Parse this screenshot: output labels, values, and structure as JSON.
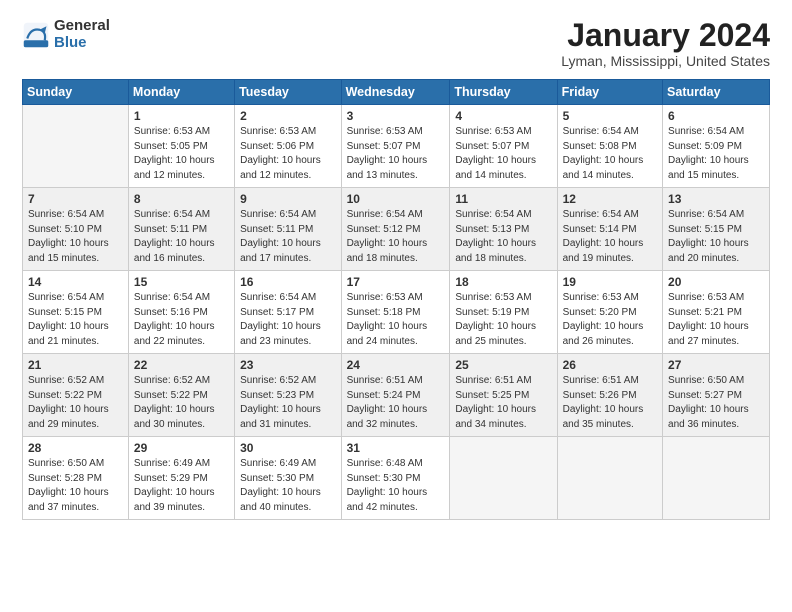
{
  "logo": {
    "general": "General",
    "blue": "Blue"
  },
  "title": "January 2024",
  "subtitle": "Lyman, Mississippi, United States",
  "days_header": [
    "Sunday",
    "Monday",
    "Tuesday",
    "Wednesday",
    "Thursday",
    "Friday",
    "Saturday"
  ],
  "weeks": [
    [
      {
        "day": "",
        "sunrise": "",
        "sunset": "",
        "daylight": "",
        "empty": true
      },
      {
        "day": "1",
        "sunrise": "Sunrise: 6:53 AM",
        "sunset": "Sunset: 5:05 PM",
        "daylight": "Daylight: 10 hours and 12 minutes."
      },
      {
        "day": "2",
        "sunrise": "Sunrise: 6:53 AM",
        "sunset": "Sunset: 5:06 PM",
        "daylight": "Daylight: 10 hours and 12 minutes."
      },
      {
        "day": "3",
        "sunrise": "Sunrise: 6:53 AM",
        "sunset": "Sunset: 5:07 PM",
        "daylight": "Daylight: 10 hours and 13 minutes."
      },
      {
        "day": "4",
        "sunrise": "Sunrise: 6:53 AM",
        "sunset": "Sunset: 5:07 PM",
        "daylight": "Daylight: 10 hours and 14 minutes."
      },
      {
        "day": "5",
        "sunrise": "Sunrise: 6:54 AM",
        "sunset": "Sunset: 5:08 PM",
        "daylight": "Daylight: 10 hours and 14 minutes."
      },
      {
        "day": "6",
        "sunrise": "Sunrise: 6:54 AM",
        "sunset": "Sunset: 5:09 PM",
        "daylight": "Daylight: 10 hours and 15 minutes."
      }
    ],
    [
      {
        "day": "7",
        "sunrise": "Sunrise: 6:54 AM",
        "sunset": "Sunset: 5:10 PM",
        "daylight": "Daylight: 10 hours and 15 minutes."
      },
      {
        "day": "8",
        "sunrise": "Sunrise: 6:54 AM",
        "sunset": "Sunset: 5:11 PM",
        "daylight": "Daylight: 10 hours and 16 minutes."
      },
      {
        "day": "9",
        "sunrise": "Sunrise: 6:54 AM",
        "sunset": "Sunset: 5:11 PM",
        "daylight": "Daylight: 10 hours and 17 minutes."
      },
      {
        "day": "10",
        "sunrise": "Sunrise: 6:54 AM",
        "sunset": "Sunset: 5:12 PM",
        "daylight": "Daylight: 10 hours and 18 minutes."
      },
      {
        "day": "11",
        "sunrise": "Sunrise: 6:54 AM",
        "sunset": "Sunset: 5:13 PM",
        "daylight": "Daylight: 10 hours and 18 minutes."
      },
      {
        "day": "12",
        "sunrise": "Sunrise: 6:54 AM",
        "sunset": "Sunset: 5:14 PM",
        "daylight": "Daylight: 10 hours and 19 minutes."
      },
      {
        "day": "13",
        "sunrise": "Sunrise: 6:54 AM",
        "sunset": "Sunset: 5:15 PM",
        "daylight": "Daylight: 10 hours and 20 minutes."
      }
    ],
    [
      {
        "day": "14",
        "sunrise": "Sunrise: 6:54 AM",
        "sunset": "Sunset: 5:15 PM",
        "daylight": "Daylight: 10 hours and 21 minutes."
      },
      {
        "day": "15",
        "sunrise": "Sunrise: 6:54 AM",
        "sunset": "Sunset: 5:16 PM",
        "daylight": "Daylight: 10 hours and 22 minutes."
      },
      {
        "day": "16",
        "sunrise": "Sunrise: 6:54 AM",
        "sunset": "Sunset: 5:17 PM",
        "daylight": "Daylight: 10 hours and 23 minutes."
      },
      {
        "day": "17",
        "sunrise": "Sunrise: 6:53 AM",
        "sunset": "Sunset: 5:18 PM",
        "daylight": "Daylight: 10 hours and 24 minutes."
      },
      {
        "day": "18",
        "sunrise": "Sunrise: 6:53 AM",
        "sunset": "Sunset: 5:19 PM",
        "daylight": "Daylight: 10 hours and 25 minutes."
      },
      {
        "day": "19",
        "sunrise": "Sunrise: 6:53 AM",
        "sunset": "Sunset: 5:20 PM",
        "daylight": "Daylight: 10 hours and 26 minutes."
      },
      {
        "day": "20",
        "sunrise": "Sunrise: 6:53 AM",
        "sunset": "Sunset: 5:21 PM",
        "daylight": "Daylight: 10 hours and 27 minutes."
      }
    ],
    [
      {
        "day": "21",
        "sunrise": "Sunrise: 6:52 AM",
        "sunset": "Sunset: 5:22 PM",
        "daylight": "Daylight: 10 hours and 29 minutes."
      },
      {
        "day": "22",
        "sunrise": "Sunrise: 6:52 AM",
        "sunset": "Sunset: 5:22 PM",
        "daylight": "Daylight: 10 hours and 30 minutes."
      },
      {
        "day": "23",
        "sunrise": "Sunrise: 6:52 AM",
        "sunset": "Sunset: 5:23 PM",
        "daylight": "Daylight: 10 hours and 31 minutes."
      },
      {
        "day": "24",
        "sunrise": "Sunrise: 6:51 AM",
        "sunset": "Sunset: 5:24 PM",
        "daylight": "Daylight: 10 hours and 32 minutes."
      },
      {
        "day": "25",
        "sunrise": "Sunrise: 6:51 AM",
        "sunset": "Sunset: 5:25 PM",
        "daylight": "Daylight: 10 hours and 34 minutes."
      },
      {
        "day": "26",
        "sunrise": "Sunrise: 6:51 AM",
        "sunset": "Sunset: 5:26 PM",
        "daylight": "Daylight: 10 hours and 35 minutes."
      },
      {
        "day": "27",
        "sunrise": "Sunrise: 6:50 AM",
        "sunset": "Sunset: 5:27 PM",
        "daylight": "Daylight: 10 hours and 36 minutes."
      }
    ],
    [
      {
        "day": "28",
        "sunrise": "Sunrise: 6:50 AM",
        "sunset": "Sunset: 5:28 PM",
        "daylight": "Daylight: 10 hours and 37 minutes."
      },
      {
        "day": "29",
        "sunrise": "Sunrise: 6:49 AM",
        "sunset": "Sunset: 5:29 PM",
        "daylight": "Daylight: 10 hours and 39 minutes."
      },
      {
        "day": "30",
        "sunrise": "Sunrise: 6:49 AM",
        "sunset": "Sunset: 5:30 PM",
        "daylight": "Daylight: 10 hours and 40 minutes."
      },
      {
        "day": "31",
        "sunrise": "Sunrise: 6:48 AM",
        "sunset": "Sunset: 5:30 PM",
        "daylight": "Daylight: 10 hours and 42 minutes."
      },
      {
        "day": "",
        "sunrise": "",
        "sunset": "",
        "daylight": "",
        "empty": true
      },
      {
        "day": "",
        "sunrise": "",
        "sunset": "",
        "daylight": "",
        "empty": true
      },
      {
        "day": "",
        "sunrise": "",
        "sunset": "",
        "daylight": "",
        "empty": true
      }
    ]
  ]
}
